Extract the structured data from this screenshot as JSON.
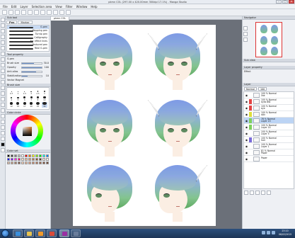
{
  "window": {
    "title": "pkmn COL (297.00 x 420.00mm 300dpi 17.1%) - Manga Studio",
    "buttons": [
      "–",
      "□",
      "✕"
    ]
  },
  "menu": [
    "File",
    "Edit",
    "Layer",
    "Selection area",
    "View",
    "Filter",
    "Window",
    "Help"
  ],
  "canvas_tab": "pkmn COL",
  "sub_tool": {
    "header": "Sub tool",
    "tabs": [
      "Pen",
      "Marker"
    ],
    "active_tab": "Pen",
    "items": [
      {
        "label": "G-pen",
        "selected": true
      },
      {
        "label": "Mapping pen",
        "selected": false
      },
      {
        "label": "Turnip pen",
        "selected": false
      },
      {
        "label": "Calligraphy",
        "selected": false
      },
      {
        "label": "For effect lines",
        "selected": false
      },
      {
        "label": "Textured pen",
        "selected": false
      },
      {
        "label": "Real G-pen",
        "selected": false
      }
    ]
  },
  "tool_property": {
    "header": "Tool property",
    "pen_name": "G-pen",
    "rows": [
      {
        "label": "Brush size",
        "value": "30.0",
        "fill": 0.62
      },
      {
        "label": "Opacity",
        "value": "100",
        "fill": 1.0
      },
      {
        "label": "Anti-alias",
        "value": "",
        "fill": 0.7
      },
      {
        "label": "Stabilization",
        "value": "10",
        "fill": 0.3
      }
    ],
    "footer": "Vector Magnet"
  },
  "brush_size": {
    "header": "Brush size",
    "sizes": [
      "0.7",
      "1",
      "1.5",
      "2",
      "2.5",
      "3",
      "4",
      "5",
      "6",
      "7",
      "8",
      "10",
      "12",
      "15",
      "17",
      "20",
      "25",
      "30"
    ]
  },
  "color_wheel": {
    "header": "Color circle",
    "current_color": "#d97a2b"
  },
  "color_set": {
    "header": "Color set",
    "colors": [
      "#000000",
      "#404040",
      "#808080",
      "#c0c0c0",
      "#ffffff",
      "#ff0000",
      "#ff8000",
      "#ffff00",
      "#80ff00",
      "#00ff00",
      "#00ffff",
      "#0080ff",
      "#0000ff",
      "#8000ff",
      "#ff00ff",
      "#ff0080",
      "#f3d9c5",
      "#e8b996",
      "#d49b72",
      "#b8754b",
      "#8e5532",
      "#603b22",
      "#f8e4d4",
      "#fff3e8",
      "#d9b9a5",
      "#c9a28b",
      "#a77f6b",
      "#866152",
      "#f0c8b0",
      "#e6b49a",
      "#dba085",
      "#c98c70",
      "#b57a60",
      "#9e6a52",
      "#875a45",
      "#704a38"
    ]
  },
  "navigator": {
    "header": "Navigator",
    "zoom": "17.1"
  },
  "sub_view": {
    "header": "Sub view"
  },
  "layer_property": {
    "header": "Layer property",
    "effect_label": "Effect"
  },
  "layer_panel": {
    "header": "Layer",
    "blend_mode": "Normal",
    "opacity": "100",
    "layers": [
      {
        "chip": "",
        "text": "100 % Normal\nline",
        "selected": false
      },
      {
        "chip": "#e34444",
        "text": "100 % Normal\neyes BW",
        "selected": false
      },
      {
        "chip": "#e34444",
        "text": "100 % Normal\neye",
        "selected": false
      },
      {
        "chip": "#dede3a",
        "text": "100 % Normal\nskin",
        "selected": false
      },
      {
        "chip": "#7ed15c",
        "text": "78 % Normal\nLayer 15",
        "selected": true
      },
      {
        "chip": "#7ed15c",
        "text": "100 % Normal\nLayer 14",
        "selected": false
      },
      {
        "chip": "",
        "text": "100 % Normal\nLayer 5",
        "selected": false
      },
      {
        "chip": "#7a6bd9",
        "text": "100 % Normal\nhair",
        "selected": false
      },
      {
        "chip": "",
        "text": "100 % Normal\nLayer 1",
        "selected": false
      },
      {
        "chip": "",
        "text": "81 % Normal\nPaper",
        "selected": false
      },
      {
        "chip": "",
        "text": "Paper",
        "selected": false
      }
    ]
  },
  "taskbar": {
    "time": "23:10",
    "date": "06/02/2015"
  }
}
